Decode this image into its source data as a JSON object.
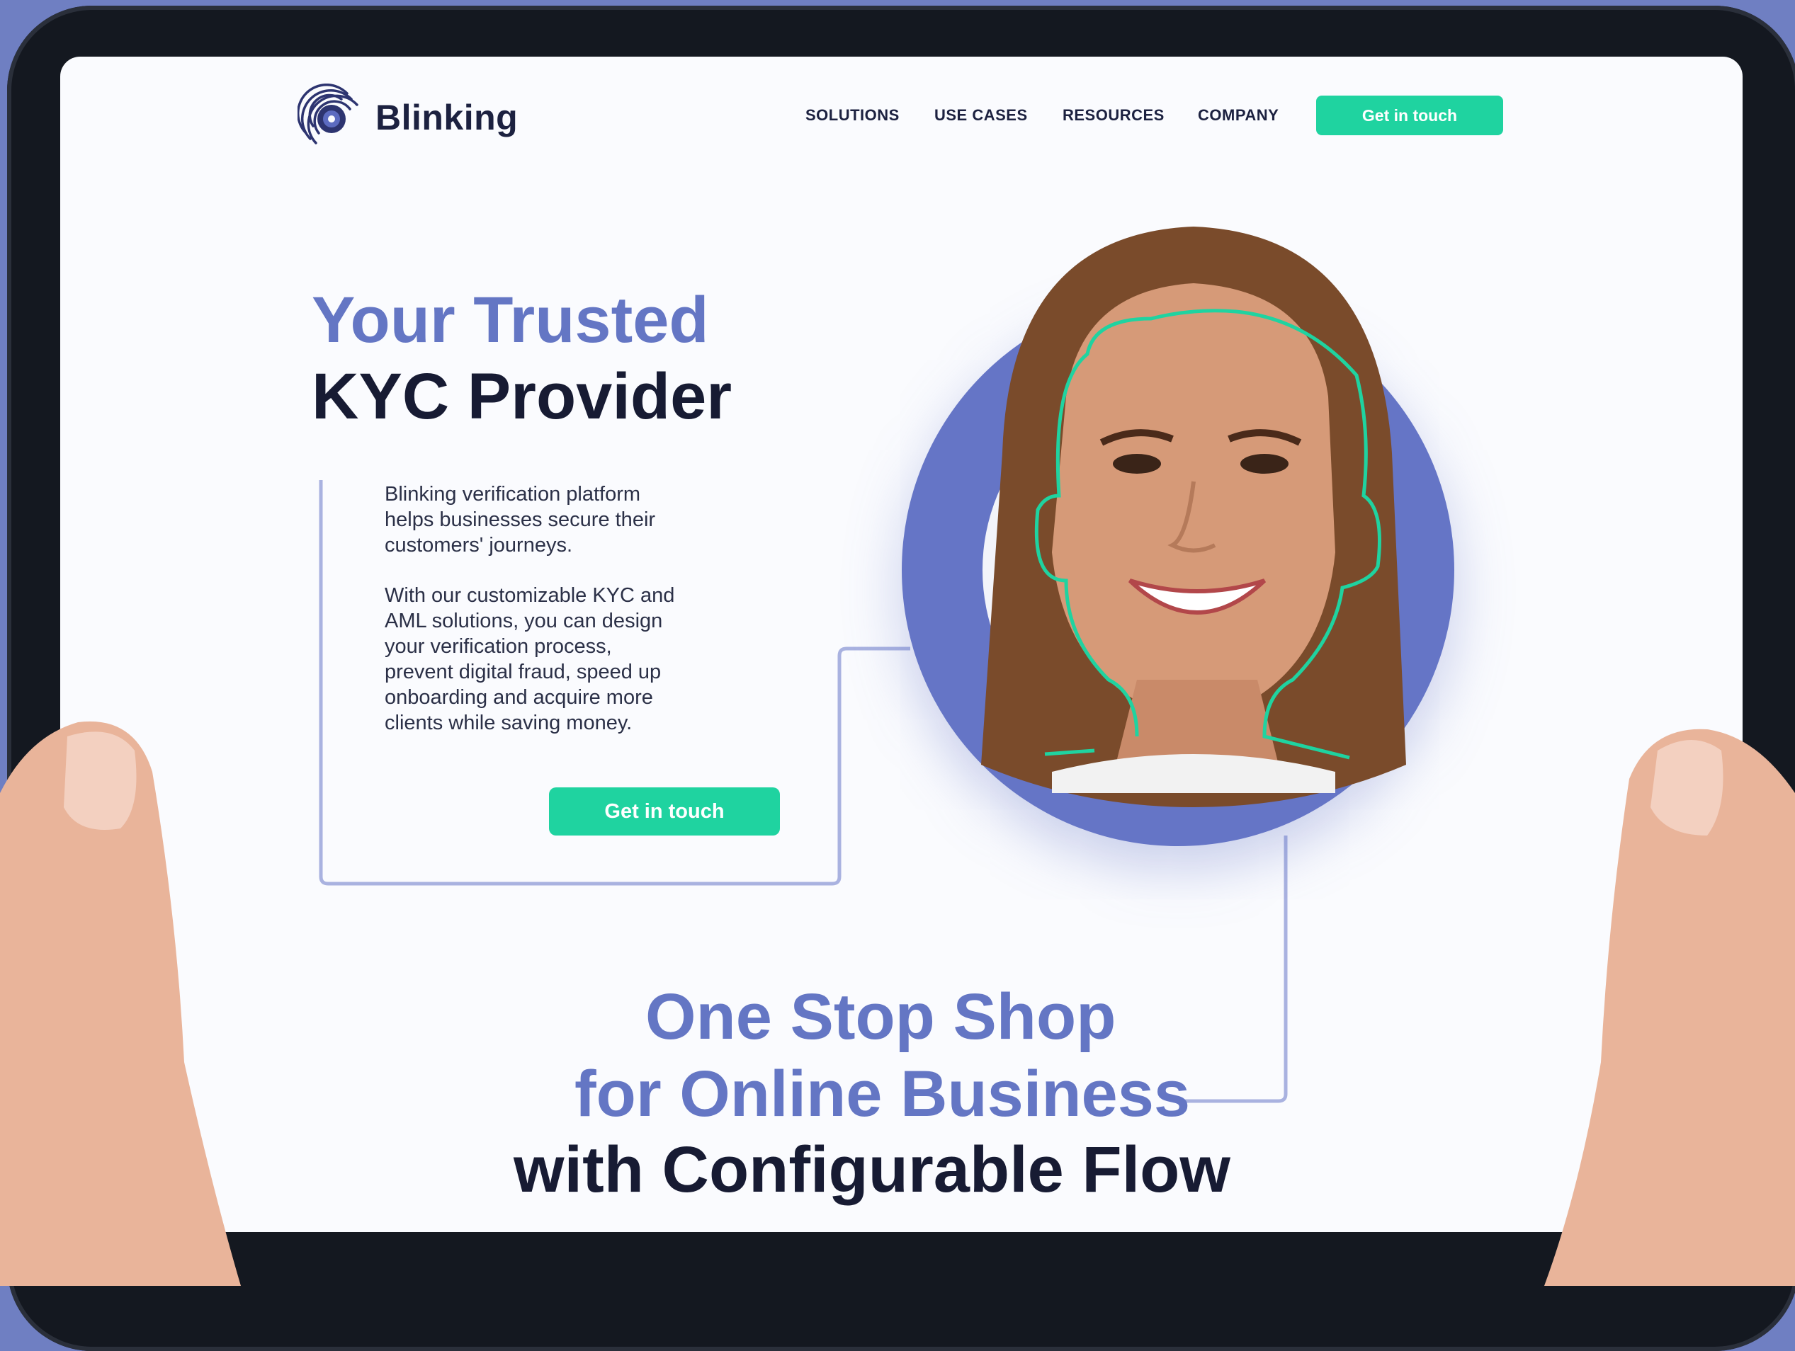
{
  "brand": {
    "name": "Blinking",
    "accent": "#6476c4",
    "cta_color": "#1fd3a0",
    "dark": "#171b33"
  },
  "nav": {
    "items": [
      "SOLUTIONS",
      "USE CASES",
      "RESOURCES",
      "COMPANY"
    ],
    "cta_label": "Get in touch"
  },
  "hero": {
    "title_line1": "Your Trusted",
    "title_line2": "KYC Provider",
    "description": [
      [
        "Blinking verification platform",
        "helps businesses secure their",
        "customers' journeys."
      ],
      [
        "With our customizable KYC and",
        "AML solutions, you can design",
        "your verification process,",
        "prevent digital fraud, speed up",
        "onboarding and acquire more",
        "clients while saving money."
      ]
    ],
    "cta_label": "Get in touch"
  },
  "section": {
    "title_line1": "One Stop Shop",
    "title_line2": "for Online Business",
    "title_line3": "with Configurable Flow"
  },
  "icons": [
    "fingerprint-logo-icon"
  ]
}
